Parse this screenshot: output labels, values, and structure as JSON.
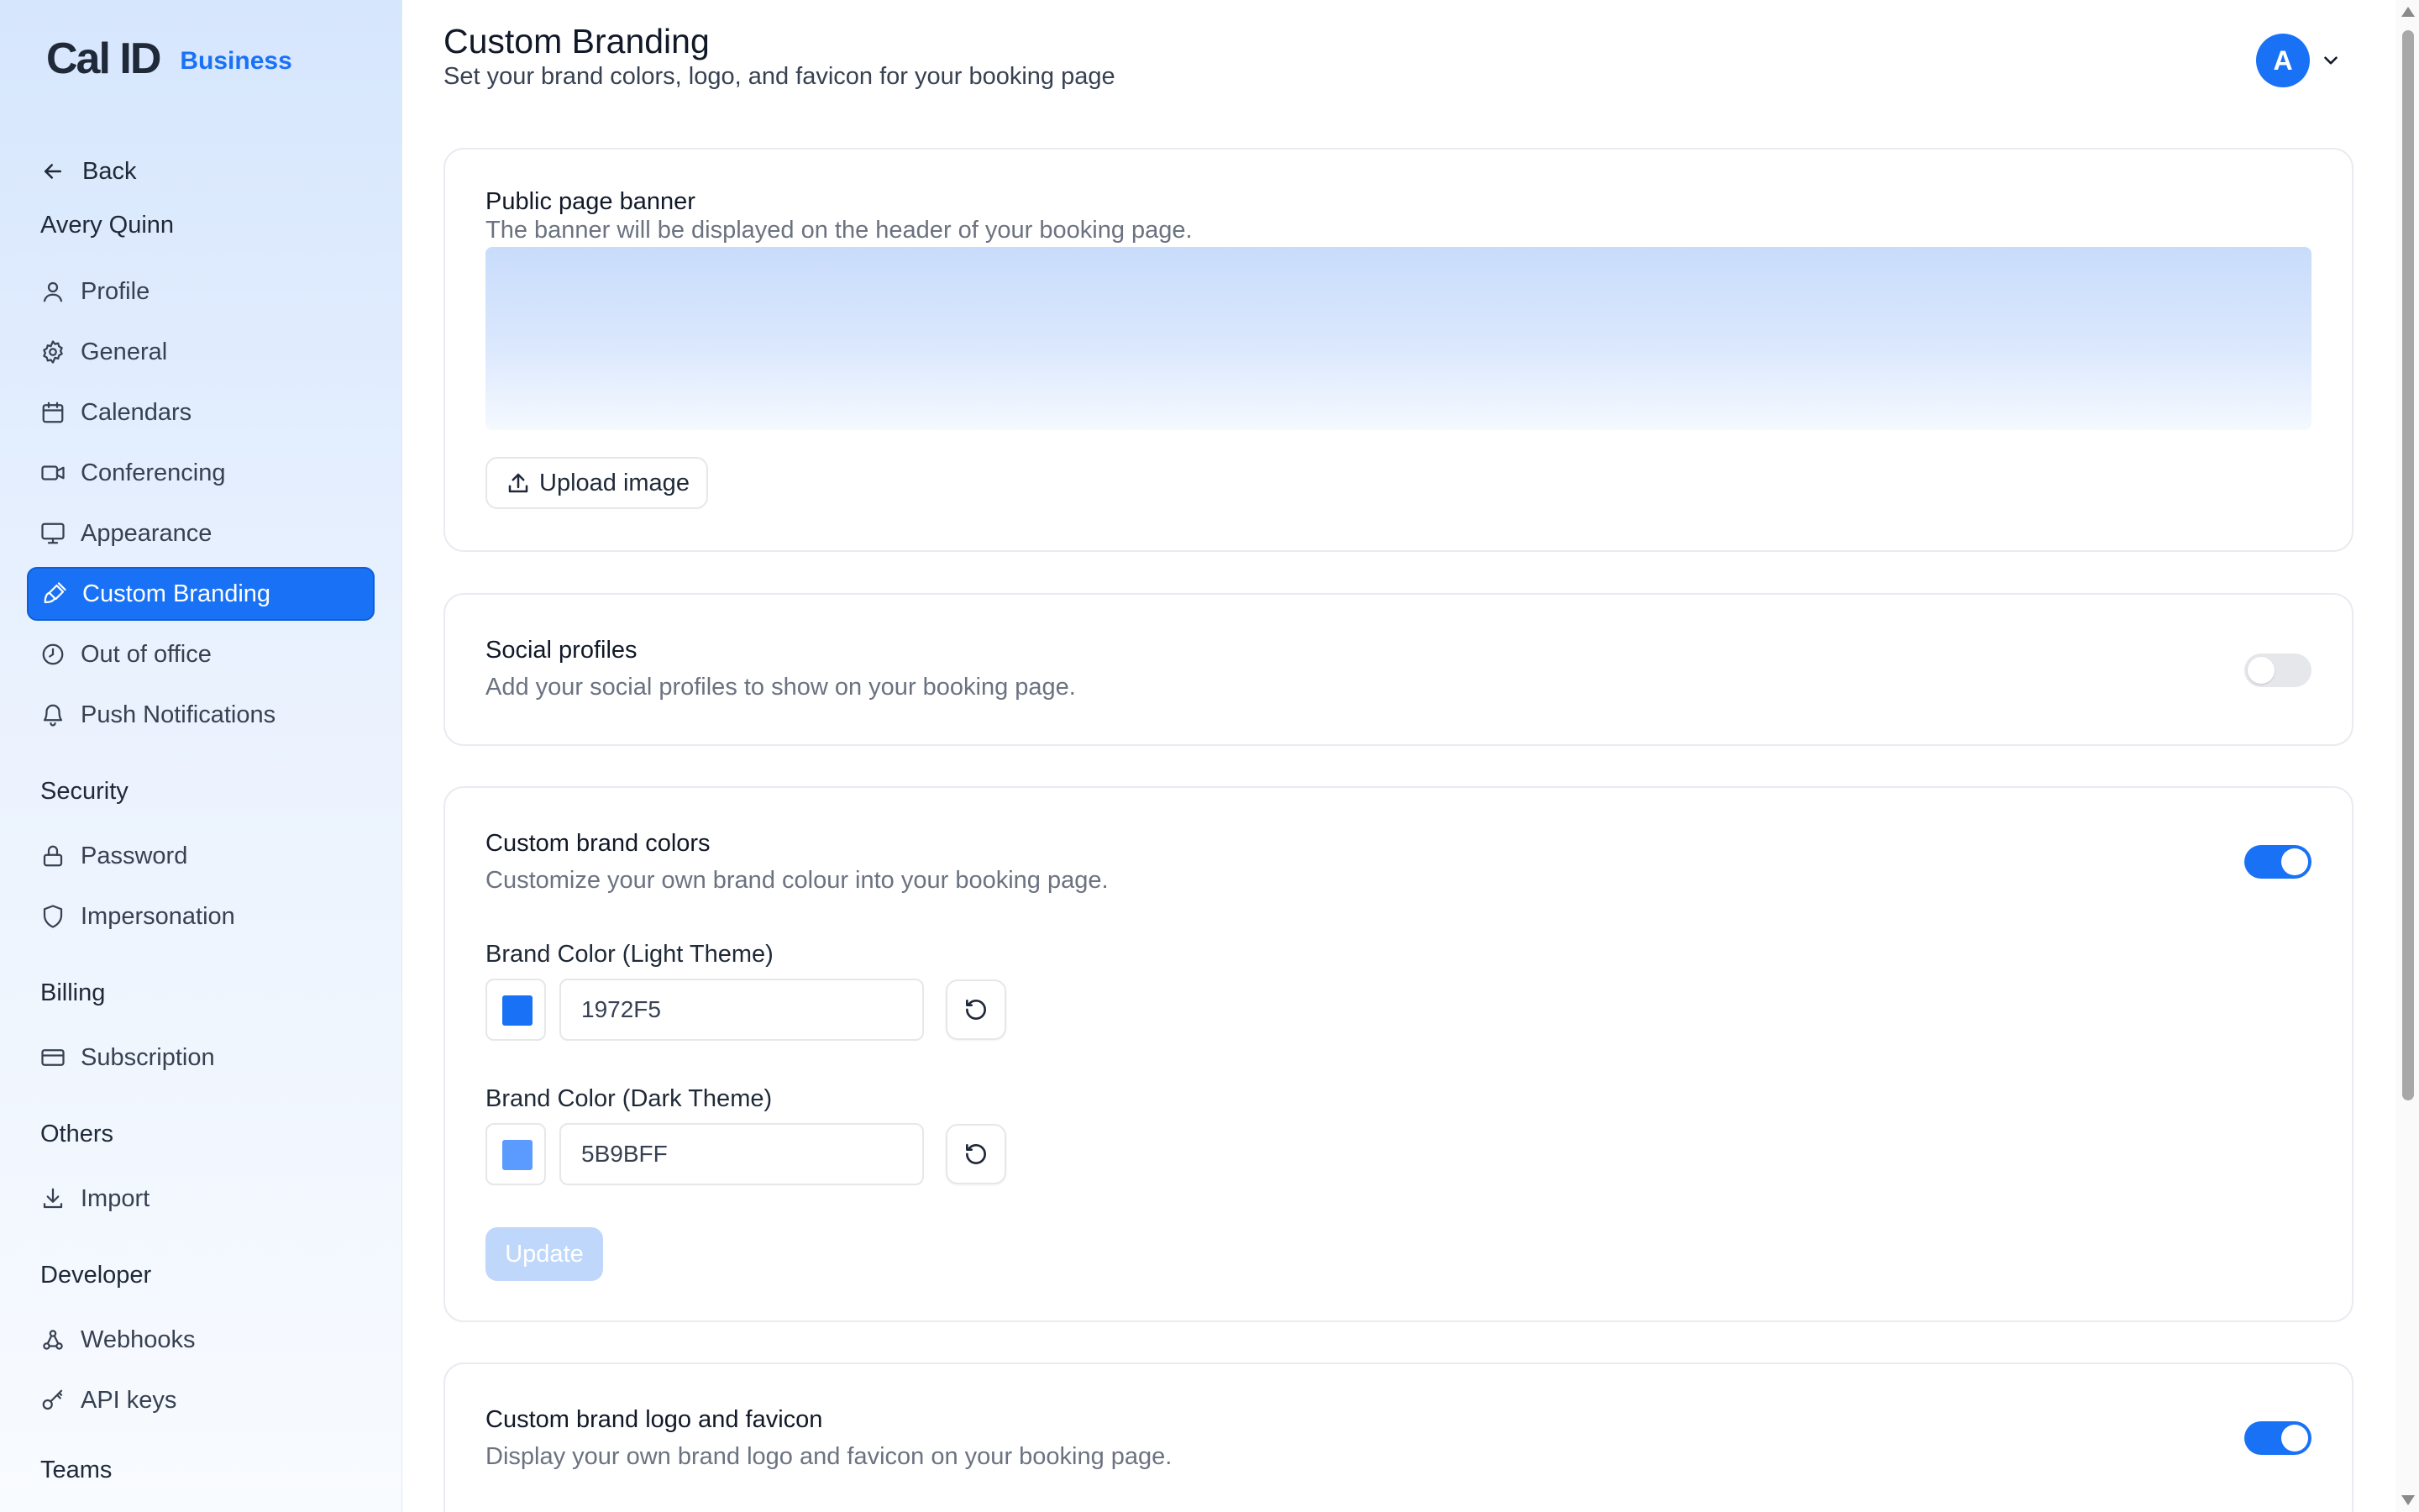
{
  "brand": {
    "logo": "Cal ID",
    "tag": "Business",
    "accent": "#1972F5"
  },
  "sidebar": {
    "back_label": "Back",
    "user_name": "Avery Quinn",
    "items": [
      {
        "label": "Profile",
        "icon": "user-icon"
      },
      {
        "label": "General",
        "icon": "gear-icon"
      },
      {
        "label": "Calendars",
        "icon": "calendar-icon"
      },
      {
        "label": "Conferencing",
        "icon": "video-icon"
      },
      {
        "label": "Appearance",
        "icon": "monitor-icon"
      },
      {
        "label": "Custom Branding",
        "icon": "paintbrush-icon",
        "active": true
      },
      {
        "label": "Out of office",
        "icon": "clock-icon"
      },
      {
        "label": "Push Notifications",
        "icon": "bell-icon"
      }
    ],
    "sections": {
      "security": {
        "title": "Security",
        "items": [
          {
            "label": "Password",
            "icon": "lock-icon"
          },
          {
            "label": "Impersonation",
            "icon": "shield-icon"
          }
        ]
      },
      "billing": {
        "title": "Billing",
        "items": [
          {
            "label": "Subscription",
            "icon": "credit-card-icon"
          }
        ]
      },
      "others": {
        "title": "Others",
        "items": [
          {
            "label": "Import",
            "icon": "download-icon"
          }
        ]
      },
      "developer": {
        "title": "Developer",
        "items": [
          {
            "label": "Webhooks",
            "icon": "webhook-icon"
          },
          {
            "label": "API keys",
            "icon": "key-icon"
          }
        ]
      },
      "teams": {
        "title": "Teams"
      }
    }
  },
  "header": {
    "title": "Custom Branding",
    "subtitle": "Set your brand colors, logo, and favicon for your booking page",
    "avatar_initial": "A"
  },
  "banner_card": {
    "title": "Public page banner",
    "description": "The banner will be displayed on the header of your booking page.",
    "upload_label": "Upload image"
  },
  "social_card": {
    "title": "Social profiles",
    "description": "Add your social profiles to show on your booking page.",
    "enabled": false
  },
  "colors_card": {
    "title": "Custom brand colors",
    "description": "Customize your own brand colour into your booking page.",
    "enabled": true,
    "light_label": "Brand Color (Light Theme)",
    "light_value": "1972F5",
    "light_swatch": "#1972F5",
    "dark_label": "Brand Color (Dark Theme)",
    "dark_value": "5B9BFF",
    "dark_swatch": "#5B9BFF",
    "update_label": "Update"
  },
  "logo_card": {
    "title": "Custom brand logo and favicon",
    "description": "Display your own brand logo and favicon on your booking page.",
    "enabled": true
  }
}
